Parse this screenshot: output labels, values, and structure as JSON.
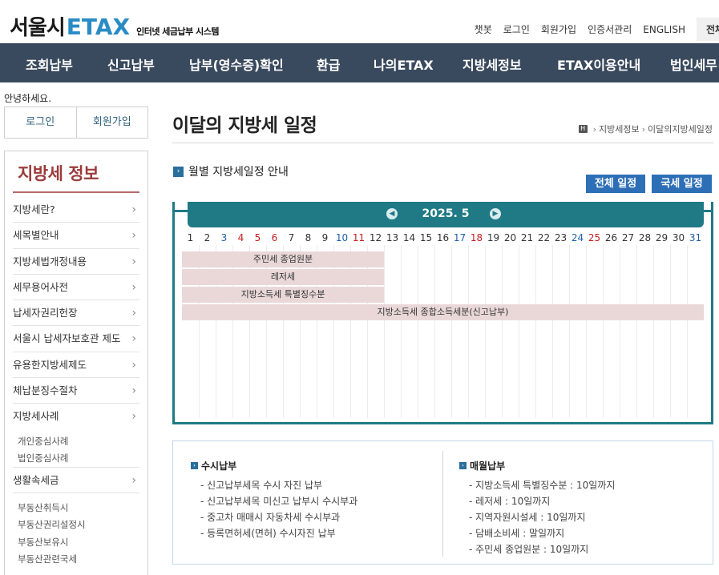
{
  "header": {
    "logo_ko": "서울시",
    "logo_etax": "ETAX",
    "logo_sub": "인터넷 세금납부 시스템",
    "util": [
      "챗봇",
      "로그인",
      "회원가입",
      "인증서관리",
      "ENGLISH"
    ],
    "allmenu": "전체"
  },
  "gnb": [
    "조회납부",
    "신고납부",
    "납부(영수증)확인",
    "환급",
    "나의ETAX",
    "지방세정보",
    "ETAX이용안내",
    "법인세무"
  ],
  "left": {
    "hello": "안녕하세요.",
    "login": "로그인",
    "join": "회원가입",
    "title": "지방세 정보",
    "items": [
      {
        "label": "지방세란?"
      },
      {
        "label": "세목별안내"
      },
      {
        "label": "지방세법개정내용"
      },
      {
        "label": "세무용어사전"
      },
      {
        "label": "납세자권리헌장"
      },
      {
        "label": "서울시 납세자보호관 제도"
      },
      {
        "label": "유용한지방세제도"
      },
      {
        "label": "체납분징수절차"
      },
      {
        "label": "지방세사례"
      }
    ],
    "sub_items_1": [
      "개인중심사례",
      "법인중심사례"
    ],
    "item_life": "생활속세금",
    "sub_items_2": [
      "부동산취득시",
      "부동산권리설정시",
      "부동산보유시",
      "부동산관련국세"
    ]
  },
  "main": {
    "title": "이달의 지방세 일정",
    "breadcrumb_home": "H",
    "breadcrumb": [
      "지방세정보",
      "이달의지방세일정"
    ],
    "section_title": "월별 지방세일정 안내",
    "btn_all": "전체 일정",
    "btn_national": "국세 일정"
  },
  "calendar": {
    "month": "2025. 5",
    "days": [
      1,
      2,
      3,
      4,
      5,
      6,
      7,
      8,
      9,
      10,
      11,
      12,
      13,
      14,
      15,
      16,
      17,
      18,
      19,
      20,
      21,
      22,
      23,
      24,
      25,
      26,
      27,
      28,
      29,
      30,
      31
    ],
    "saturdays": [
      3,
      10,
      17,
      24,
      31
    ],
    "sundays": [
      4,
      11,
      18,
      25
    ],
    "holidays": [
      5,
      6
    ],
    "events": [
      {
        "label": "주민세 종업원분",
        "start": 1,
        "end": 12
      },
      {
        "label": "레저세",
        "start": 1,
        "end": 12
      },
      {
        "label": "지방소득세 특별징수분",
        "start": 1,
        "end": 12
      },
      {
        "label": "지방소득세 종합소득세분(신고납부)",
        "start": 1,
        "end": 31
      }
    ]
  },
  "info": {
    "left_title": "수시납부",
    "left_items": [
      "- 신고납부세목 수시 자진 납부",
      "- 신고납부세목 미신고 납부시 수시부과",
      "- 중고차 매매시 자동차세 수시부과",
      "- 등록면허세(면허) 수시자진 납부"
    ],
    "right_title": "매월납부",
    "right_items": [
      "- 지방소득세 특별징수분 : 10일까지",
      "- 레저세 : 10일까지",
      "- 지역자원시설세 : 10일까지",
      "- 담배소비세 : 말일까지",
      "- 주민세 종업원분 : 10일까지"
    ]
  },
  "colors": {
    "gnb": "#3a4a5e",
    "accent": "#1f7a86",
    "lnb_title": "#9b3a3a",
    "event_bar": "#ead8d8",
    "button": "#2d6fb6"
  }
}
